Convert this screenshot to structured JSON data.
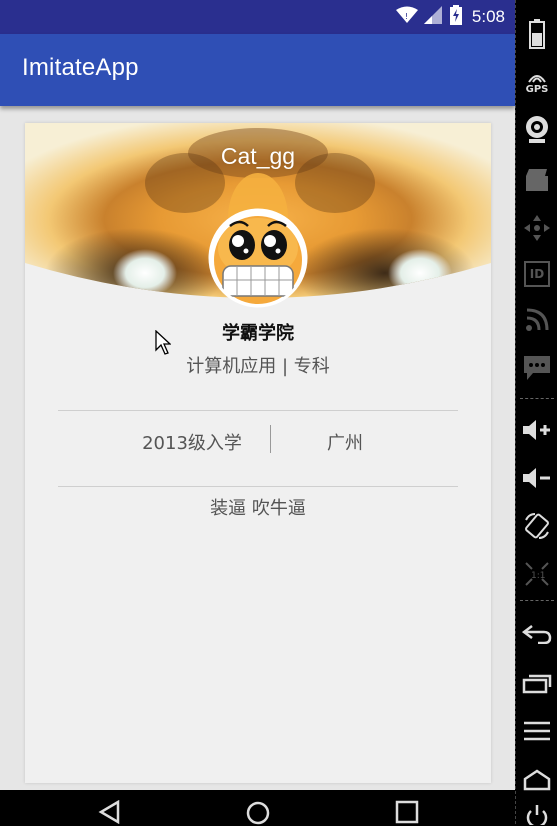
{
  "status_bar": {
    "time": "5:08"
  },
  "app_bar": {
    "title": "ImitateApp"
  },
  "profile": {
    "username": "Cat_gg",
    "school": "学霸学院",
    "major": "计算机应用 | 专科",
    "enrollment": "2013级入学",
    "city": "广州",
    "motto": "装逼 吹牛逼"
  },
  "side_panel": {
    "gps_label": "GPS",
    "id_label": "ID",
    "buttons": [
      "battery-icon",
      "gps-icon",
      "camera-icon",
      "video-icon",
      "dpad-icon",
      "id-icon",
      "rss-icon",
      "sms-icon",
      "volume-up-icon",
      "volume-down-icon",
      "rotate-icon",
      "scale-icon",
      "back-icon",
      "recents-icon",
      "menu-icon",
      "home-icon",
      "power-icon"
    ]
  },
  "nav_bar": {
    "buttons": [
      "back-icon",
      "home-icon",
      "recents-icon"
    ]
  },
  "colors": {
    "status_bar": "#2a2f8f",
    "app_bar": "#2f4fb5",
    "card": "#f0f0f0",
    "header_orange": "#f0a63a"
  }
}
